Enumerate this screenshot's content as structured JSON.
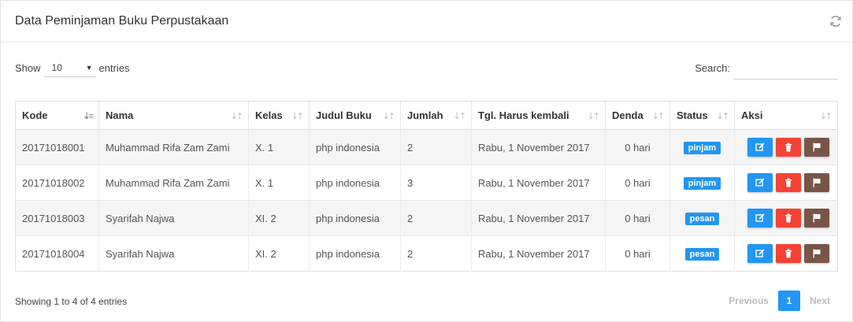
{
  "panel": {
    "title": "Data Peminjaman Buku Perpustakaan"
  },
  "controls": {
    "show_label": "Show",
    "page_length": "10",
    "entries_label": "entries",
    "search_label": "Search:",
    "search_value": ""
  },
  "table": {
    "columns": [
      "Kode",
      "Nama",
      "Kelas",
      "Judul Buku",
      "Jumlah",
      "Tgl. Harus kembali",
      "Denda",
      "Status",
      "Aksi"
    ],
    "rows": [
      {
        "kode": "20171018001",
        "nama": "Muhammad Rifa Zam Zami",
        "kelas": "X. 1",
        "judul": "php indonesia",
        "jumlah": "2",
        "tgl": "Rabu, 1 November 2017",
        "denda": "0 hari",
        "status": "pinjam"
      },
      {
        "kode": "20171018002",
        "nama": "Muhammad Rifa Zam Zami",
        "kelas": "X. 1",
        "judul": "php indonesia",
        "jumlah": "3",
        "tgl": "Rabu, 1 November 2017",
        "denda": "0 hari",
        "status": "pinjam"
      },
      {
        "kode": "20171018003",
        "nama": "Syarifah Najwa",
        "kelas": "XI. 2",
        "judul": "php indonesia",
        "jumlah": "2",
        "tgl": "Rabu, 1 November 2017",
        "denda": "0 hari",
        "status": "pesan"
      },
      {
        "kode": "20171018004",
        "nama": "Syarifah Najwa",
        "kelas": "XI. 2",
        "judul": "php indonesia",
        "jumlah": "2",
        "tgl": "Rabu, 1 November 2017",
        "denda": "0 hari",
        "status": "pesan"
      }
    ]
  },
  "footer": {
    "info": "Showing 1 to 4 of 4 entries",
    "previous": "Previous",
    "current_page": "1",
    "next": "Next"
  },
  "icons": {
    "refresh": "refresh-icon",
    "edit": "edit-icon",
    "delete": "trash-icon",
    "flag": "flag-icon",
    "sort": "sort-icon"
  },
  "colors": {
    "accent": "#2196f3",
    "edit_button": "#2196f3",
    "delete_button": "#f44336",
    "flag_button": "#795548",
    "link": "#3a6fb0"
  }
}
